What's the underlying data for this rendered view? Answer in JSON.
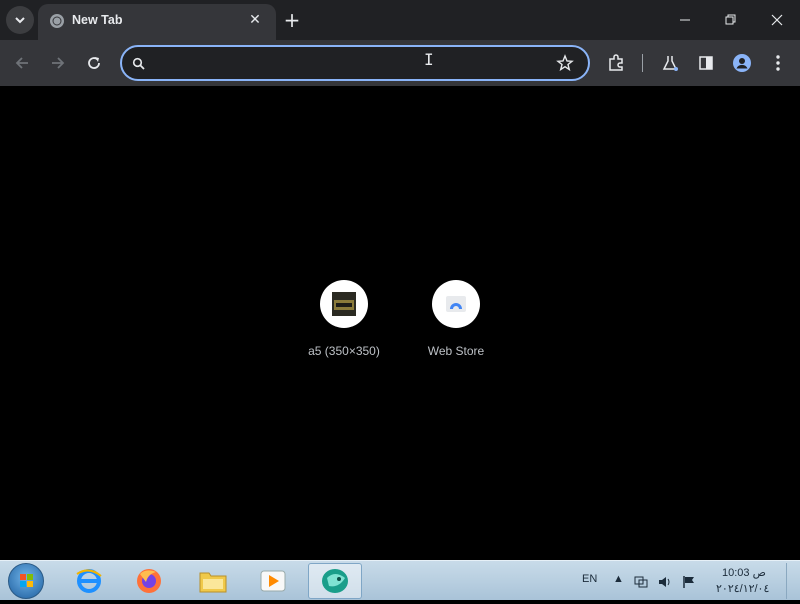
{
  "browser": {
    "tab": {
      "title": "New Tab"
    },
    "omnibox": {
      "value": "",
      "placeholder": ""
    }
  },
  "shortcuts": [
    {
      "label": "a5 (350×350)"
    },
    {
      "label": "Web Store"
    }
  ],
  "taskbar": {
    "language": "EN",
    "time": "10:03 ص",
    "date": "٢٠٢٤/١٢/٠٤"
  },
  "colors": {
    "accent": "#8ab4f8",
    "tabstrip": "#202124",
    "toolbar": "#35363a"
  }
}
